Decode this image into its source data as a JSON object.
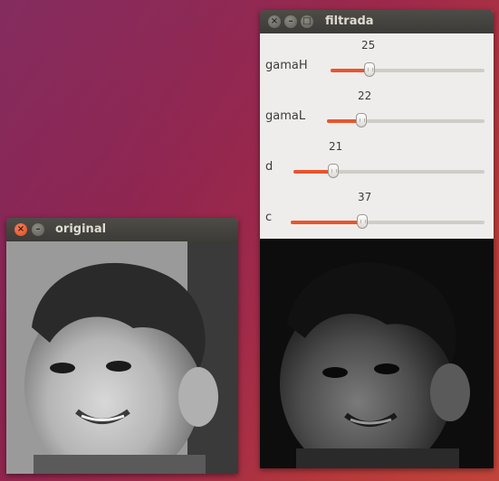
{
  "windows": {
    "filtrada": {
      "title": "filtrada",
      "trackbars": [
        {
          "label": "gamaH",
          "value": "25",
          "fill_fraction": 0.25
        },
        {
          "label": "gamaL",
          "value": "22",
          "fill_fraction": 0.22
        },
        {
          "label": "d",
          "value": "21",
          "fill_fraction": 0.21
        },
        {
          "label": "c",
          "value": "37",
          "fill_fraction": 0.37
        }
      ],
      "image": {
        "content": "filtered grayscale photo of a smiling baby (dark, homomorphic filter)"
      }
    },
    "original": {
      "title": "original",
      "image": {
        "content": "original grayscale photo of a smiling baby"
      }
    }
  },
  "colors": {
    "accent": "#e9552e",
    "titlebar": "#3c3b37",
    "panel": "#efedeb",
    "close_button": "#e0491a"
  },
  "icons": {
    "close": "close-icon",
    "minimize": "minimize-icon",
    "maximize": "maximize-icon"
  }
}
